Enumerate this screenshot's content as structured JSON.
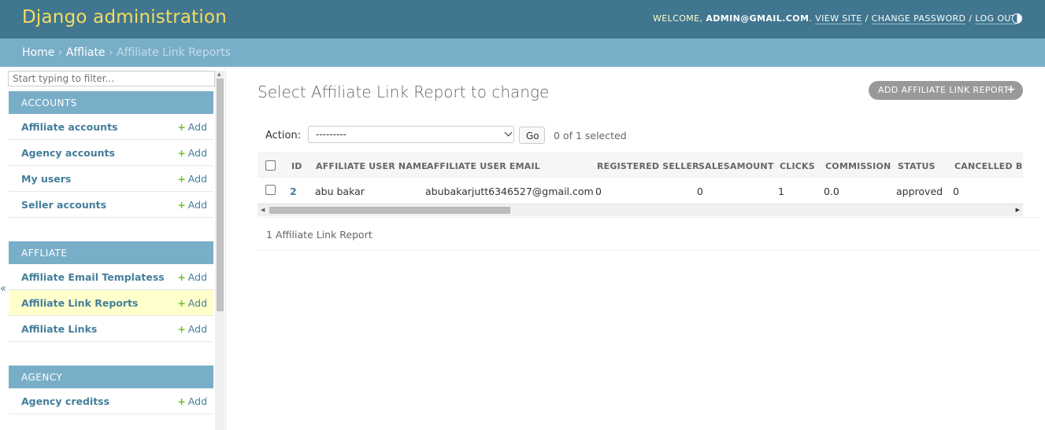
{
  "header": {
    "branding": "Django administration",
    "welcome": "WELCOME,",
    "user": "ADMIN@GMAIL.COM",
    "view_site": "VIEW SITE",
    "change_password": "CHANGE PASSWORD",
    "log_out": "LOG OUT",
    "sep": "/",
    "theme_icon": "theme-toggle-icon"
  },
  "breadcrumbs": {
    "home": "Home",
    "app": "Affliate",
    "current": "Affiliate Link Reports",
    "sep": "›"
  },
  "sidebar": {
    "filter_placeholder": "Start typing to filter...",
    "add_label": "Add",
    "add_icon": "+",
    "collapse_icon": "«",
    "modules": [
      {
        "caption": "ACCOUNTS",
        "items": [
          "Affiliate accounts",
          "Agency accounts",
          "My users",
          "Seller accounts"
        ]
      },
      {
        "caption": "AFFLIATE",
        "items": [
          "Affiliate Email Templatess",
          "Affiliate Link Reports",
          "Affiliate Links"
        ],
        "current_item": "Affiliate Link Reports"
      },
      {
        "caption": "AGENCY",
        "items": [
          "Agency creditss"
        ]
      }
    ]
  },
  "content": {
    "title": "Select Affiliate Link Report to change",
    "add_button": "ADD AFFILIATE LINK REPORT",
    "add_icon": "+",
    "action_label": "Action:",
    "action_selected": "---------",
    "go_label": "Go",
    "selection_counter": "0 of 1 selected",
    "columns": [
      "ID",
      "AFFILIATE USER NAME",
      "AFFILIATE USER EMAIL",
      "REGISTERED SELLER",
      "SALESAMOUNT",
      "CLICKS",
      "COMMISSION",
      "STATUS",
      "CANCELLED BAA"
    ],
    "rows": [
      {
        "id": "2",
        "user_name": "abu bakar",
        "email": "abubakarjutt6346527@gmail.com",
        "registered_seller": "0",
        "salesamount": "0",
        "clicks": "1",
        "commission": "0.0",
        "status": "approved",
        "cancelled": "0"
      }
    ],
    "paginator": "1 Affiliate Link Report"
  },
  "colors": {
    "header_bg": "#417690",
    "branding": "#f5dd5d",
    "breadcrumb_bg": "#79aec8",
    "module_caption_bg": "#79aec8",
    "link": "#447e9b",
    "add_plus": "#70bf2b",
    "current_row_bg": "#ffffcc"
  }
}
